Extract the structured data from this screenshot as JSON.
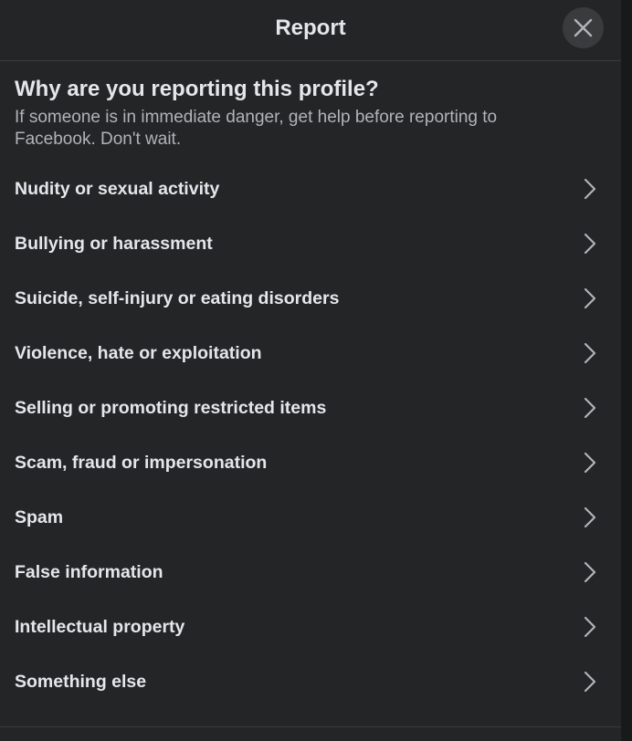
{
  "header": {
    "title": "Report",
    "close_icon": "close-icon"
  },
  "prompt": {
    "question": "Why are you reporting this profile?",
    "subtext": "If someone is in immediate danger, get help before reporting to Facebook. Don't wait."
  },
  "options": [
    {
      "label": "Nudity or sexual activity",
      "icon": "chevron-right-icon"
    },
    {
      "label": "Bullying or harassment",
      "icon": "chevron-right-icon"
    },
    {
      "label": "Suicide, self-injury or eating disorders",
      "icon": "chevron-right-icon"
    },
    {
      "label": "Violence, hate or exploitation",
      "icon": "chevron-right-icon"
    },
    {
      "label": "Selling or promoting restricted items",
      "icon": "chevron-right-icon"
    },
    {
      "label": "Scam, fraud or impersonation",
      "icon": "chevron-right-icon"
    },
    {
      "label": "Spam",
      "icon": "chevron-right-icon"
    },
    {
      "label": "False information",
      "icon": "chevron-right-icon"
    },
    {
      "label": "Intellectual property",
      "icon": "chevron-right-icon"
    },
    {
      "label": "Something else",
      "icon": "chevron-right-icon"
    }
  ],
  "colors": {
    "background": "#242526",
    "primary_text": "#e4e6eb",
    "secondary_text": "#b0b3b8",
    "close_button_bg": "#3a3b3c",
    "divider": "#393a3b"
  }
}
